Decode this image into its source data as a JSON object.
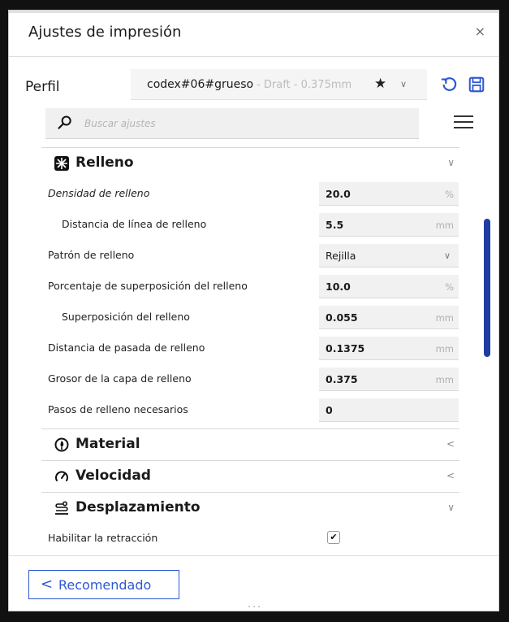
{
  "window": {
    "title": "Ajustes de impresión",
    "close_label": "×"
  },
  "profile": {
    "label": "Perfil",
    "name": "codex#06#grueso",
    "subtitle": "- Draft - 0.375mm"
  },
  "search": {
    "placeholder": "Buscar ajustes",
    "value": ""
  },
  "sections": {
    "infill": {
      "title": "Relleno",
      "expanded": true,
      "icon": "infill-icon"
    },
    "material": {
      "title": "Material",
      "expanded": false,
      "icon": "material-icon"
    },
    "speed": {
      "title": "Velocidad",
      "expanded": false,
      "icon": "speed-icon"
    },
    "travel": {
      "title": "Desplazamiento",
      "expanded": true,
      "icon": "travel-icon"
    }
  },
  "infill_settings": [
    {
      "label": "Densidad de relleno",
      "value": "20.0",
      "unit": "%"
    },
    {
      "label": "Distancia de línea de relleno",
      "value": "5.5",
      "unit": "mm"
    },
    {
      "label": "Patrón de relleno",
      "value": "Rejilla",
      "unit": ""
    },
    {
      "label": "Porcentaje de superposición del relleno",
      "value": "10.0",
      "unit": "%"
    },
    {
      "label": "Superposición del relleno",
      "value": "0.055",
      "unit": "mm"
    },
    {
      "label": "Distancia de pasada de relleno",
      "value": "0.1375",
      "unit": "mm"
    },
    {
      "label": "Grosor de la capa de relleno",
      "value": "0.375",
      "unit": "mm"
    },
    {
      "label": "Pasos de relleno necesarios",
      "value": "0",
      "unit": ""
    }
  ],
  "travel_settings": [
    {
      "label": "Habilitar la retracción",
      "checked": true,
      "check_glyph": "✔"
    }
  ],
  "footer": {
    "recommended_label": "Recomendado",
    "back_glyph": "<"
  },
  "colors": {
    "accent": "#2e57d6",
    "scrollbar": "#1e3ea3"
  }
}
